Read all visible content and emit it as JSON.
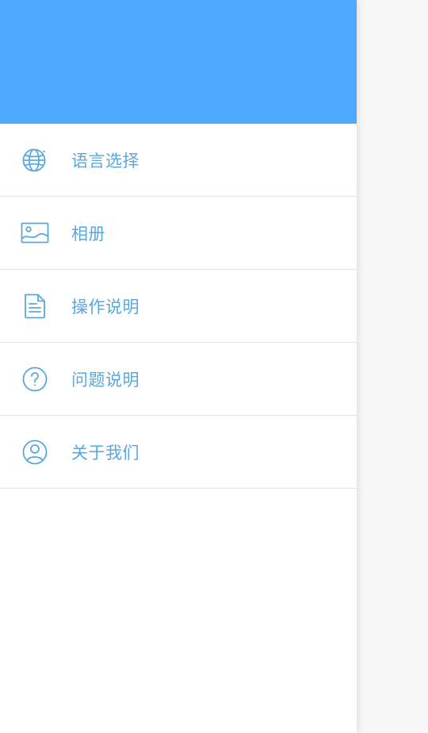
{
  "drawer": {
    "header_color": "#4faaff",
    "accent_color": "#58a8e0",
    "items": [
      {
        "label": "语言选择",
        "icon": "globe-icon"
      },
      {
        "label": "相册",
        "icon": "image-icon"
      },
      {
        "label": "操作说明",
        "icon": "document-icon"
      },
      {
        "label": "问题说明",
        "icon": "question-circle-icon"
      },
      {
        "label": "关于我们",
        "icon": "user-circle-icon"
      }
    ]
  }
}
